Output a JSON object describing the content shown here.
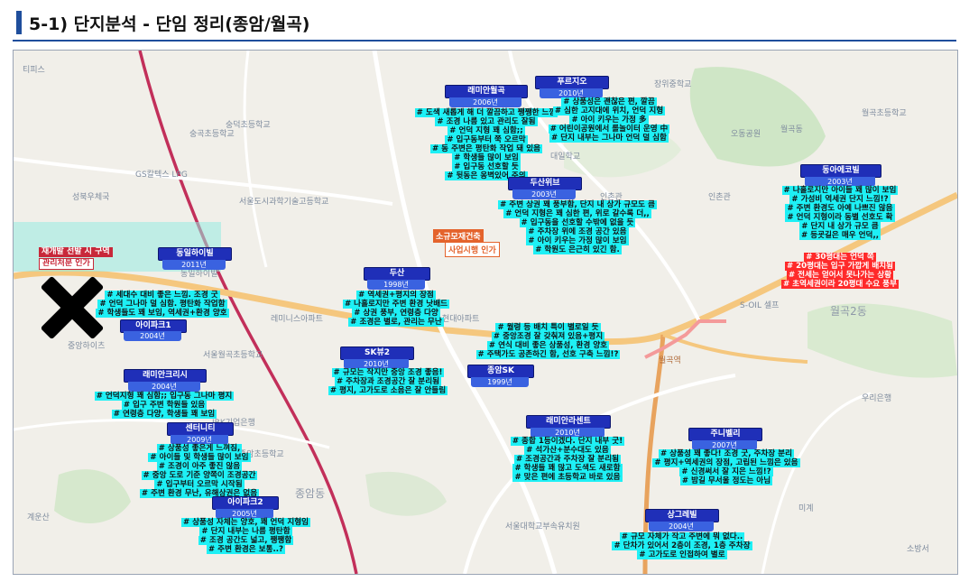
{
  "page": {
    "title": "5-1) 단지분석 - 단임 정리(종암/월곡)"
  },
  "map_labels": [
    "티피스",
    "숭덕초등학교",
    "GS칼텍스 LPG",
    "성북우체국",
    "서울도시과학기술고등학교",
    "동일하이빌",
    "중앙하이츠",
    "종암동",
    "서울월곡초등학교",
    "레미니스아파트",
    "현대아파트",
    "IBK기업은행",
    "월곡2동",
    "월곡역",
    "S-OIL 셀프",
    "숭곡초등학교",
    "오동공원",
    "인촌관",
    "계운산",
    "소방서",
    "장위중학교",
    "인촌관",
    "월곡동",
    "우리은행",
    "종암초등학교",
    "서울대학교부속유치원",
    "월곡초등학교",
    "대일학교",
    "미계"
  ],
  "pois": {
    "red": [
      "재개발 선발 시 구역",
      "관리처분 인가"
    ],
    "orange": [
      "소규모재건축",
      "사업시행 인가"
    ]
  },
  "complexes": [
    {
      "name": "래미안월곡",
      "year": "2006년",
      "notes": [
        "# 도색 새롭게 해 더 깔끔하고 쨍쨍한 느낌",
        "# 조경 나름 있고 관리도 잘됨",
        "# 언덕 지형 꽤 심함;;",
        "# 입구동부터 쭉 오르막",
        "# 동 주변은 평탄화 작업 돼 있음",
        "# 학생들 많이 보임",
        "# 입구동 선호할 듯",
        "# 뒷동은 옹벽있어 주의"
      ]
    },
    {
      "name": "푸르지오",
      "year": "2010년",
      "notes": [
        "# 상품성은 괜찮은 편, 깔끔",
        "# 심한 고지대에 위치, 언덕 지형",
        "# 아이 키우는 가정 多",
        "# 어린이공원에서 롤놀이터 운영 中",
        "# 단지 내부는 그나마 언덕 덜 심함"
      ]
    },
    {
      "name": "두산위브",
      "year": "2003년",
      "notes": [
        "# 주변 상권 꽤 풍부함, 단지 내 상가 규모도 큼",
        "# 언덕 지형은 꽤 심한 편, 위로 갈수록 더,,",
        "# 입구동을 선호할 수밖에 없을 듯",
        "# 주차장 위에 조경 공간 있음",
        "# 아이 키우는 가정 많이 보임",
        "# 학원도 은근히 있긴 함."
      ]
    },
    {
      "name": "동아에코빌",
      "year": "2003년",
      "notes": [
        "# 나홀로지만 아이들 꽤 많이 보임",
        "# 가성비 역세권 단지 느낌!?",
        "# 주변 환경도 아예 나쁘진 않음",
        "# 언덕 지형이라 동별 선호도 확",
        "# 단지 내 상가 규모 큼",
        "# 등굣길은 매우 언덕,,"
      ],
      "red_notes": [
        "# 30평대는 언덕 쪽",
        "# 20평대는 입구 가깝게 배치됨",
        "# 전세는 얻어서 못나가는 상황",
        "# 초역세권이라 20평대 수요 풍부"
      ]
    },
    {
      "name": "동일하이빌",
      "year": "2011년",
      "notes": []
    },
    {
      "name": "아이파크1",
      "year": "2004년",
      "notes": [
        "# 세대수 대비 좋은 느낌. 조경 굿",
        "# 언덕 그나마 덜 심함. 평탄화 작업함",
        "# 학생들도 꽤 보임, 역세권+환경 양호"
      ]
    },
    {
      "name": "두산",
      "year": "1998년",
      "notes": [
        "# 역세권+평지의 장점",
        "# 나홀로지만 주변 환경 낫배드",
        "# 상권 풍부, 연령층 다양",
        "# 조경은 별로, 관리는 무난"
      ]
    },
    {
      "name": "SK뷰2",
      "year": "2010년",
      "notes": [
        "# 월령 등 배치 특이 별로일 듯",
        "# 중앙조경 잘 갖춰져 있음+평지",
        "# 연식 대비 좋은 상품성, 환경 양호",
        "# 주택가도 공존하긴 함, 선호 구축 느낌!?"
      ]
    },
    {
      "name": "종암SK",
      "year": "1999년",
      "notes": [
        "# 규모는 작지만 중앙 조경 좋음!",
        "# 주차장과 조경공간 잘 분리됨",
        "# 평지, 고가도로 소음은 잘 안들림"
      ]
    },
    {
      "name": "래미안크리시",
      "year": "2004년",
      "notes": [
        "# 언덕지형 꽤 심함;; 입구동 그나마 평지",
        "# 입구 주변 학원들 있음",
        "# 연령층 다양, 학생들 꽤 보임"
      ]
    },
    {
      "name": "센터니티",
      "year": "2009년",
      "notes": [
        "# 상품성 좋은게 느껴짐,",
        "# 아이들 및 학생들 많이 보임",
        "# 조경이 아주 좋진 않음",
        "# 중앙 도로 기준 양쪽이 조경공간",
        "# 입구부터 오르막 시작됨",
        "# 주변 환경 무난, 유해상권은 없음"
      ]
    },
    {
      "name": "래미안라센트",
      "year": "2010년",
      "notes": [
        "# 종합 1등이겠다. 단지 내부 굿!",
        "# 석가산+분수대도 있음",
        "# 조경공간과 주차장 잘 분리됨",
        "# 학생들 꽤 많고 도색도 새로함",
        "# 맞은 편에 초등학교 바로 있음"
      ]
    },
    {
      "name": "주니벨리",
      "year": "2007년",
      "notes": [
        "# 상품성 꽤 좋다! 조경 굿, 주차장 분리",
        "# 평지+역세권의 장점, 고립된 느낌은 있음",
        "# 신경써서 잘 지은 느낌!?",
        "# 밤길 무서울 정도는 아님"
      ]
    },
    {
      "name": "아이파크2",
      "year": "2005년",
      "notes": [
        "# 상품성 자체는 양호, 꽤 언덕 지형임",
        "# 단지 내부는 나름 평탄함",
        "# 조경 공간도 넓고, 쨍쨍함",
        "# 주변 환경은 보통..?"
      ]
    },
    {
      "name": "상그레빌",
      "year": "2004년",
      "notes": [
        "# 규모 자체가 작고 주변에 뭐 없다..",
        "# 단차가 있어서 2층이 조경, 1층 주차장",
        "# 고가도로 인접하여 별로"
      ]
    }
  ]
}
